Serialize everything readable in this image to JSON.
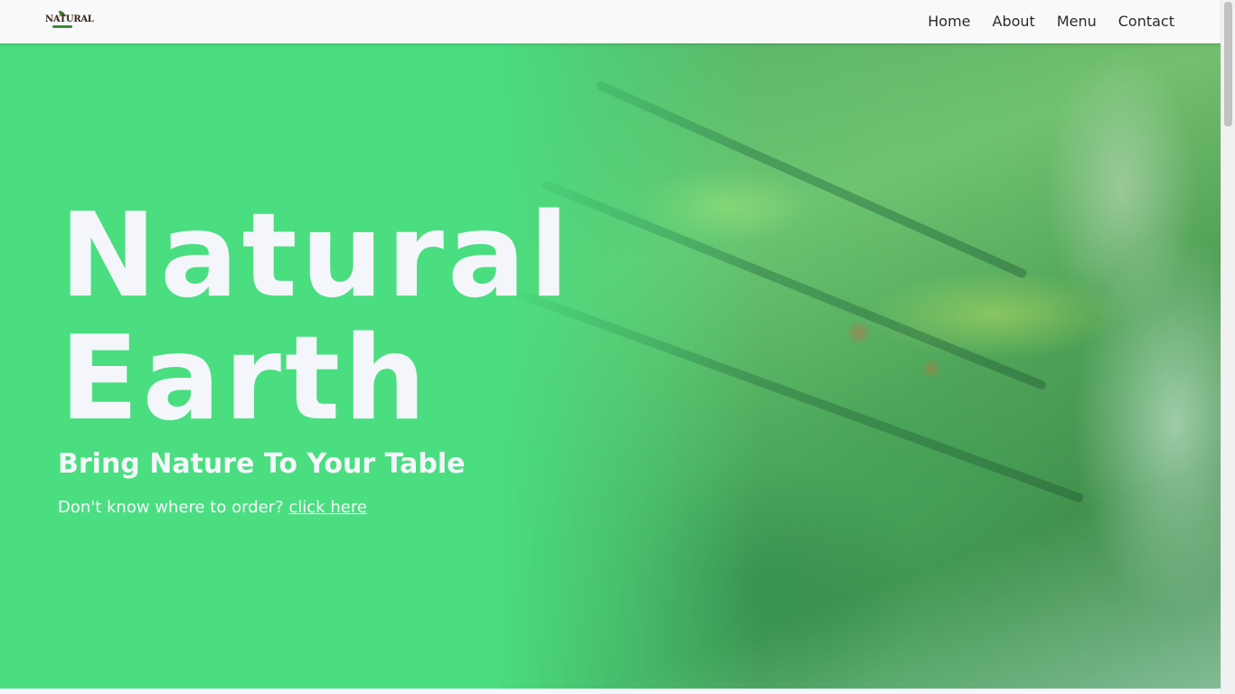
{
  "navbar": {
    "logo_text": "NATURAL",
    "links": [
      {
        "label": "Home"
      },
      {
        "label": "About"
      },
      {
        "label": "Menu"
      },
      {
        "label": "Contact"
      }
    ]
  },
  "hero": {
    "title_line1": "Natural",
    "title_line2": "Earth",
    "subtitle": "Bring Nature To Your Table",
    "cta_text": "Don't know where to order?",
    "cta_link": "click here",
    "accent_color": "#4ade80",
    "background_image": "blurred-vegetable-shelf-photo"
  }
}
